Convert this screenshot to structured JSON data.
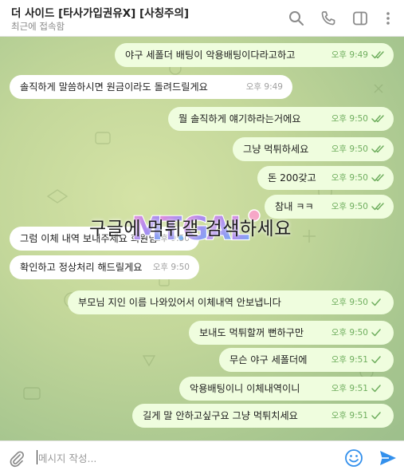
{
  "header": {
    "title": "더 사이드 [타사가입권유X] [사칭주의]",
    "status": "최근에 접속함"
  },
  "messages": [
    {
      "side": "out",
      "text": "야구 세폴더 배팅이 악용배팅이다라고하고",
      "time": "오후 9:49",
      "read": true
    },
    {
      "side": "in",
      "text": "솔직하게 말씀하시면 원금이라도 돌려드릴게요",
      "time": "오후 9:49"
    },
    {
      "side": "out",
      "text": "뭘 솔직하게 얘기하라는거에요",
      "time": "오후 9:50",
      "read": true
    },
    {
      "side": "out",
      "text": "그냥 먹튀하세요",
      "time": "오후 9:50",
      "read": true
    },
    {
      "side": "out",
      "text": "돈 200갖고",
      "time": "오후 9:50",
      "read": true
    },
    {
      "side": "out",
      "text": "참내 ㅋㅋ",
      "time": "오후 9:50",
      "read": true
    },
    {
      "side": "in",
      "text": "그럼 이체 내역 보내주세요 회원님",
      "time": "오후 9:50"
    },
    {
      "side": "in",
      "text": "확인하고 정상처리 해드릴게요",
      "time": "오후 9:50"
    },
    {
      "side": "out",
      "text": "부모님 지인 이름 나와있어서 이체내역 안보냅니다",
      "time": "오후 9:50",
      "read": false
    },
    {
      "side": "out",
      "text": "보내도 먹튀할꺼 뻔하구만",
      "time": "오후 9:50",
      "read": false
    },
    {
      "side": "out",
      "text": "무슨 야구 세폴더에",
      "time": "오후 9:51",
      "read": false
    },
    {
      "side": "out",
      "text": "악용배팅이니 이체내역이니",
      "time": "오후 9:51",
      "read": false
    },
    {
      "side": "out",
      "text": "길게 말 안하고싶구요 그냥 먹튀치세요",
      "time": "오후 9:51",
      "read": false
    }
  ],
  "watermark": {
    "logo": "MTGAL",
    "text": "구글에 먹튀갤 검색하세요"
  },
  "composer": {
    "placeholder": "메시지 작성..."
  },
  "icons": [
    "search-icon",
    "phone-icon",
    "sidebar-toggle-icon",
    "more-vert-icon",
    "attach-icon",
    "emoji-icon",
    "send-icon"
  ],
  "colors": {
    "outgoing_bubble": "#effdde",
    "incoming_bubble": "#ffffff",
    "accent": "#3390ec",
    "check": "#6fae5e"
  }
}
